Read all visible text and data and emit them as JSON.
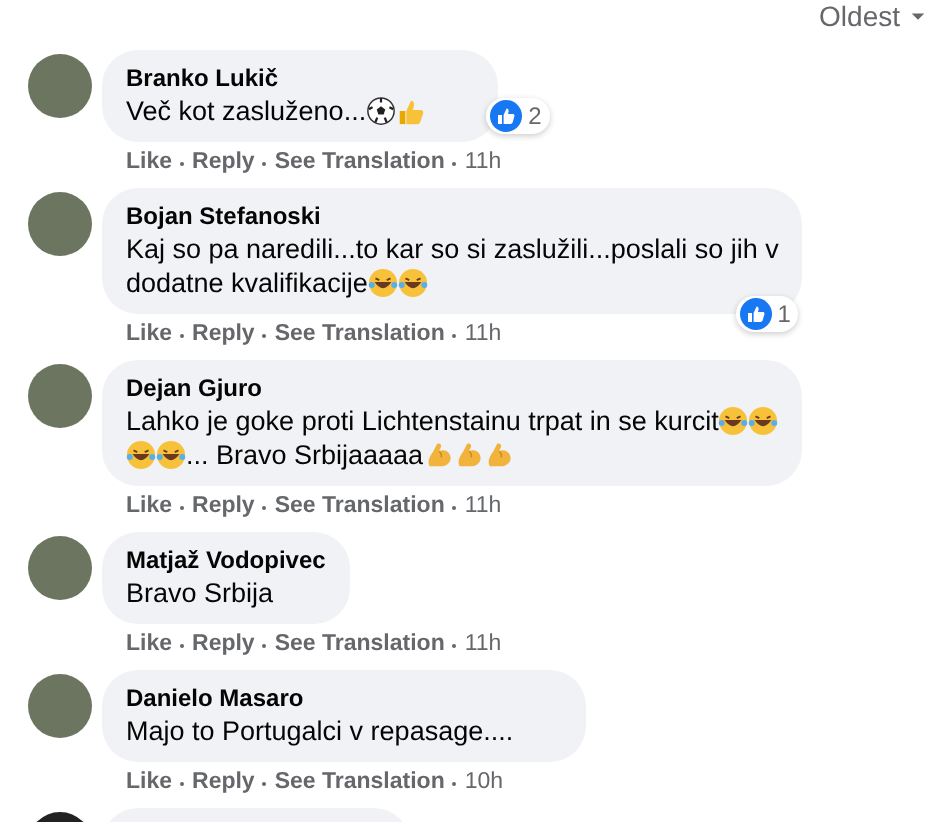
{
  "sort": {
    "label": "Oldest"
  },
  "comments": [
    {
      "author": "Branko Lukič",
      "lines": [
        [
          {
            "kind": "text",
            "text": "Več kot zasluženo... "
          },
          {
            "kind": "soccer"
          },
          {
            "kind": "thumbs"
          }
        ]
      ],
      "reaction": {
        "count": "2"
      },
      "actions": [
        "Like",
        "Reply",
        "See Translation"
      ],
      "time": "11h"
    },
    {
      "author": "Bojan Stefanoski",
      "lines": [
        [
          {
            "kind": "text",
            "text": "Kaj so pa naredili...to kar so si zaslužili...poslali so jih v"
          }
        ],
        [
          {
            "kind": "text",
            "text": "dodatne kvalifikacije "
          },
          {
            "kind": "laugh"
          },
          {
            "kind": "laugh"
          }
        ]
      ],
      "reaction": {
        "count": "1"
      },
      "actions": [
        "Like",
        "Reply",
        "See Translation"
      ],
      "time": "11h"
    },
    {
      "author": "Dejan Gjuro",
      "lines": [
        [
          {
            "kind": "text",
            "text": "Lahko je goke proti Lichtenstainu trpat in se kurcit"
          },
          {
            "kind": "laugh"
          },
          {
            "kind": "laugh"
          }
        ],
        [
          {
            "kind": "laugh"
          },
          {
            "kind": "laugh"
          },
          {
            "kind": "text",
            "text": "... Bravo Srbijaaaaa"
          },
          {
            "kind": "muscle"
          },
          {
            "kind": "muscle"
          },
          {
            "kind": "muscle"
          }
        ]
      ],
      "actions": [
        "Like",
        "Reply",
        "See Translation"
      ],
      "time": "11h"
    },
    {
      "author": "Matjaž Vodopivec",
      "lines": [
        [
          {
            "kind": "text",
            "text": "Bravo Srbija"
          }
        ]
      ],
      "actions": [
        "Like",
        "Reply",
        "See Translation"
      ],
      "time": "11h"
    },
    {
      "author": "Danielo Masaro",
      "lines": [
        [
          {
            "kind": "text",
            "text": "Majo to Portugalci v repasage...."
          }
        ]
      ],
      "actions": [
        "Like",
        "Reply",
        "See Translation"
      ],
      "time": "10h"
    }
  ],
  "partial_comment": true
}
